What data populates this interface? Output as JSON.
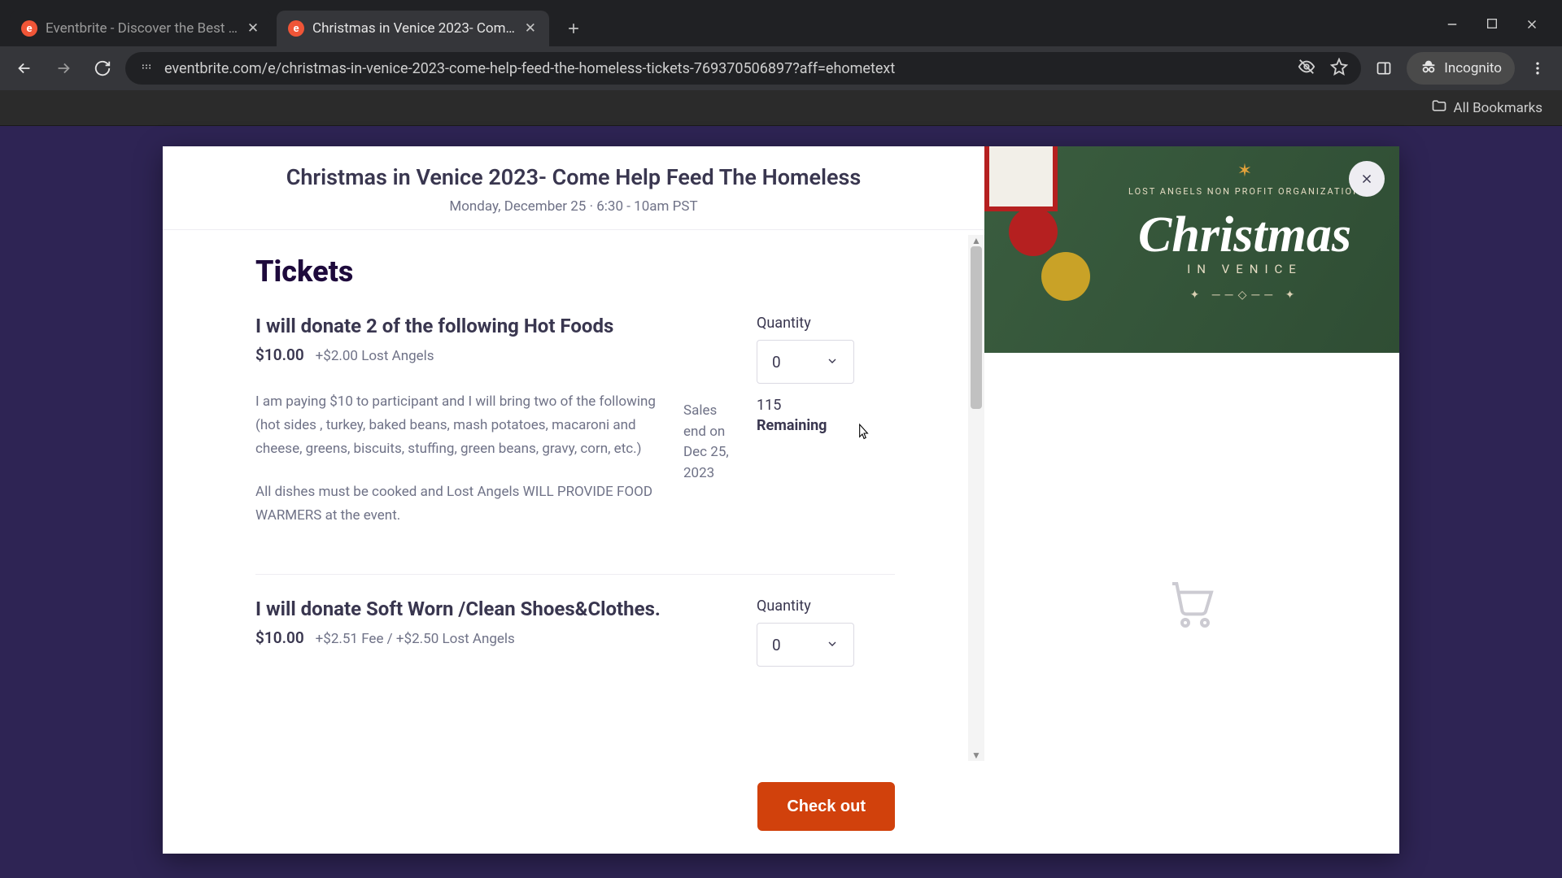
{
  "browser": {
    "tabs": [
      {
        "title": "Eventbrite - Discover the Best …"
      },
      {
        "title": "Christmas in Venice 2023- Com…"
      }
    ],
    "url": "eventbrite.com/e/christmas-in-venice-2023-come-help-feed-the-homeless-tickets-769370506897?aff=ehometext",
    "incognito_label": "Incognito",
    "bookmarks_label": "All Bookmarks"
  },
  "modal": {
    "event_title": "Christmas in Venice 2023- Come Help Feed The Homeless",
    "event_datetime": "Monday, December 25 · 6:30 - 10am PST",
    "tickets_heading": "Tickets",
    "checkout_label": "Check out",
    "image": {
      "org_line": "LOST ANGELS NON PROFIT ORGANIZATION",
      "headline": "Christmas",
      "subline": "IN VENICE",
      "ornament": "✦ ──◇── ✦"
    }
  },
  "tickets": [
    {
      "name": "I will donate 2 of the following Hot Foods",
      "price": "$10.00",
      "fee": "+$2.00 Lost Angels",
      "desc1": "I am paying $10 to participant and I will bring two of the following (hot sides , turkey, baked beans, mash potatoes, macaroni and cheese, greens, biscuits, stuffing, green beans, gravy, corn, etc.)",
      "desc2": "All dishes must be cooked  and Lost Angels WILL PROVIDE  FOOD WARMERS at the event.",
      "sales_end": "Sales end on Dec 25, 2023",
      "qty_label": "Quantity",
      "qty_value": "0",
      "remaining_count": "115",
      "remaining_label": "Remaining"
    },
    {
      "name": "I will donate Soft Worn /Clean Shoes&Clothes.",
      "price": "$10.00",
      "fee": "+$2.51 Fee   /  +$2.50 Lost Angels",
      "qty_label": "Quantity",
      "qty_value": "0"
    }
  ]
}
